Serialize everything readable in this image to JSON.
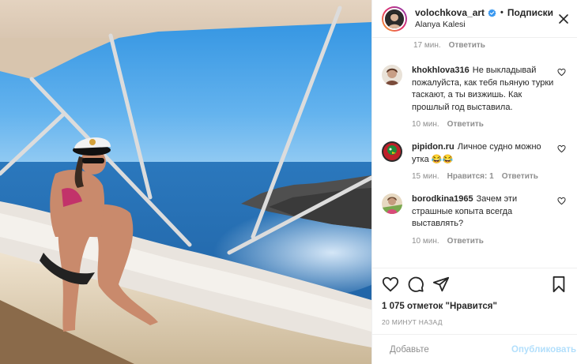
{
  "header": {
    "username": "volochkova_art",
    "verified_icon": "verified-badge-icon",
    "dot": "•",
    "follow_label": "Подписки",
    "location": "Alanya Kalesi",
    "more_icon": "close-icon"
  },
  "previous_comment": {
    "time": "17 мин.",
    "reply_label": "Ответить"
  },
  "comments": [
    {
      "user": "khokhlova316",
      "text": "Не выкладывай пожалуйста, как тебя пьяную турки таскают, а ты визжишь. Как прошлый год выставила.",
      "time": "10 мин.",
      "likes": "",
      "reply_label": "Ответить"
    },
    {
      "user": "pipidon.ru",
      "text": "Личное судно можно утка 😂😂",
      "time": "15 мин.",
      "likes": "Нравится: 1",
      "reply_label": "Ответить"
    },
    {
      "user": "borodkina1965",
      "text": "Зачем эти страшные копыта всегда выставлять?",
      "time": "10 мин.",
      "likes": "",
      "reply_label": "Ответить"
    }
  ],
  "actions": {
    "likes_text": "1 075 отметок \"Нравится\"",
    "date_text": "20 МИНУТ НАЗАД"
  },
  "add_comment": {
    "placeholder": "Добавьте",
    "publish_label": "Опубликовать"
  },
  "colors": {
    "verified": "#3897f0",
    "publish_disabled": "#b2dffc",
    "muted": "#8e8e8e"
  }
}
